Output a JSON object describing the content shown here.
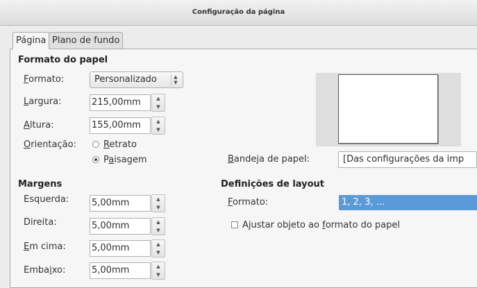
{
  "window": {
    "title": "Configuração da página"
  },
  "tabs": [
    {
      "label": "Página",
      "active": true
    },
    {
      "label": "Plano de fundo",
      "active": false
    }
  ],
  "paper_format": {
    "heading": "Formato do papel",
    "format": {
      "label_first": "F",
      "label_rest": "ormato:",
      "value": "Personalizado"
    },
    "width": {
      "label_first": "L",
      "label_rest": "argura:",
      "value": "215,00mm"
    },
    "height": {
      "label_first": "A",
      "label_rest": "ltura:",
      "value": "155,00mm"
    },
    "orientation": {
      "label_first": "O",
      "label_rest": "rientação:",
      "options": [
        {
          "first": "R",
          "rest": "etrato",
          "selected": false
        },
        {
          "pre": "P",
          "u": "a",
          "rest": "isagem",
          "selected": true
        }
      ]
    },
    "paper_tray": {
      "label_first": "B",
      "label_rest": "andeja de papel:",
      "value": "[Das configurações da imp"
    }
  },
  "margins": {
    "heading": "Margens",
    "left": {
      "label": "Esquerda:",
      "value": "5,00mm"
    },
    "right": {
      "label": "Direita:",
      "value": "5,00mm"
    },
    "top": {
      "label_first": "E",
      "label_rest": "m cima:",
      "value": "5,00mm"
    },
    "bottom": {
      "label_pre": "Emba",
      "label_u": "i",
      "label_rest": "xo:",
      "value": "5,00mm"
    }
  },
  "layout": {
    "heading": "Definições de layout",
    "format": {
      "label_first": "F",
      "label_rest": "ormato:",
      "value": "1, 2, 3, ..."
    },
    "fit_checkbox": {
      "pre": "Ajustar objeto ao ",
      "u": "f",
      "rest": "ormato do papel",
      "checked": false
    }
  },
  "colors": {
    "accent": "#5b9ad9",
    "panel": "#f6f6f6"
  }
}
